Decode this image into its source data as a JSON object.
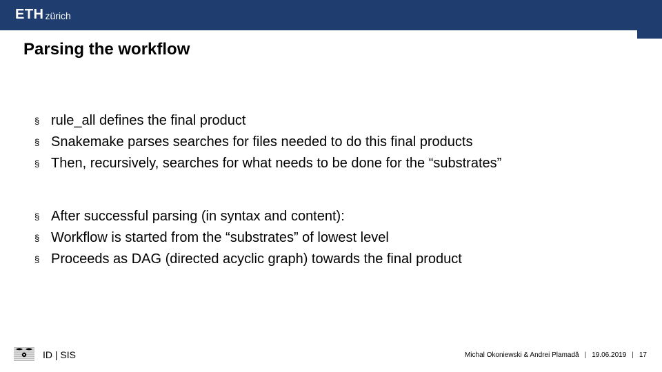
{
  "header": {
    "logo_main": "ETH",
    "logo_sub": "zürich"
  },
  "title": "Parsing the workflow",
  "bullets_group1": [
    "rule_all defines the final product",
    "Snakemake parses searches for files needed to do this final products",
    "Then, recursively, searches for what needs to be done for the “substrates”"
  ],
  "bullets_group2": [
    "After successful parsing (in syntax and content):",
    "Workflow is started from the “substrates” of lowest level",
    "Proceeds as DAG (directed acyclic graph) towards the final product"
  ],
  "footer": {
    "left": "ID | SIS",
    "authors": "Michal Okoniewski & Andrei Plamadă",
    "date": "19.06.2019",
    "page": "17",
    "sep": "|"
  }
}
